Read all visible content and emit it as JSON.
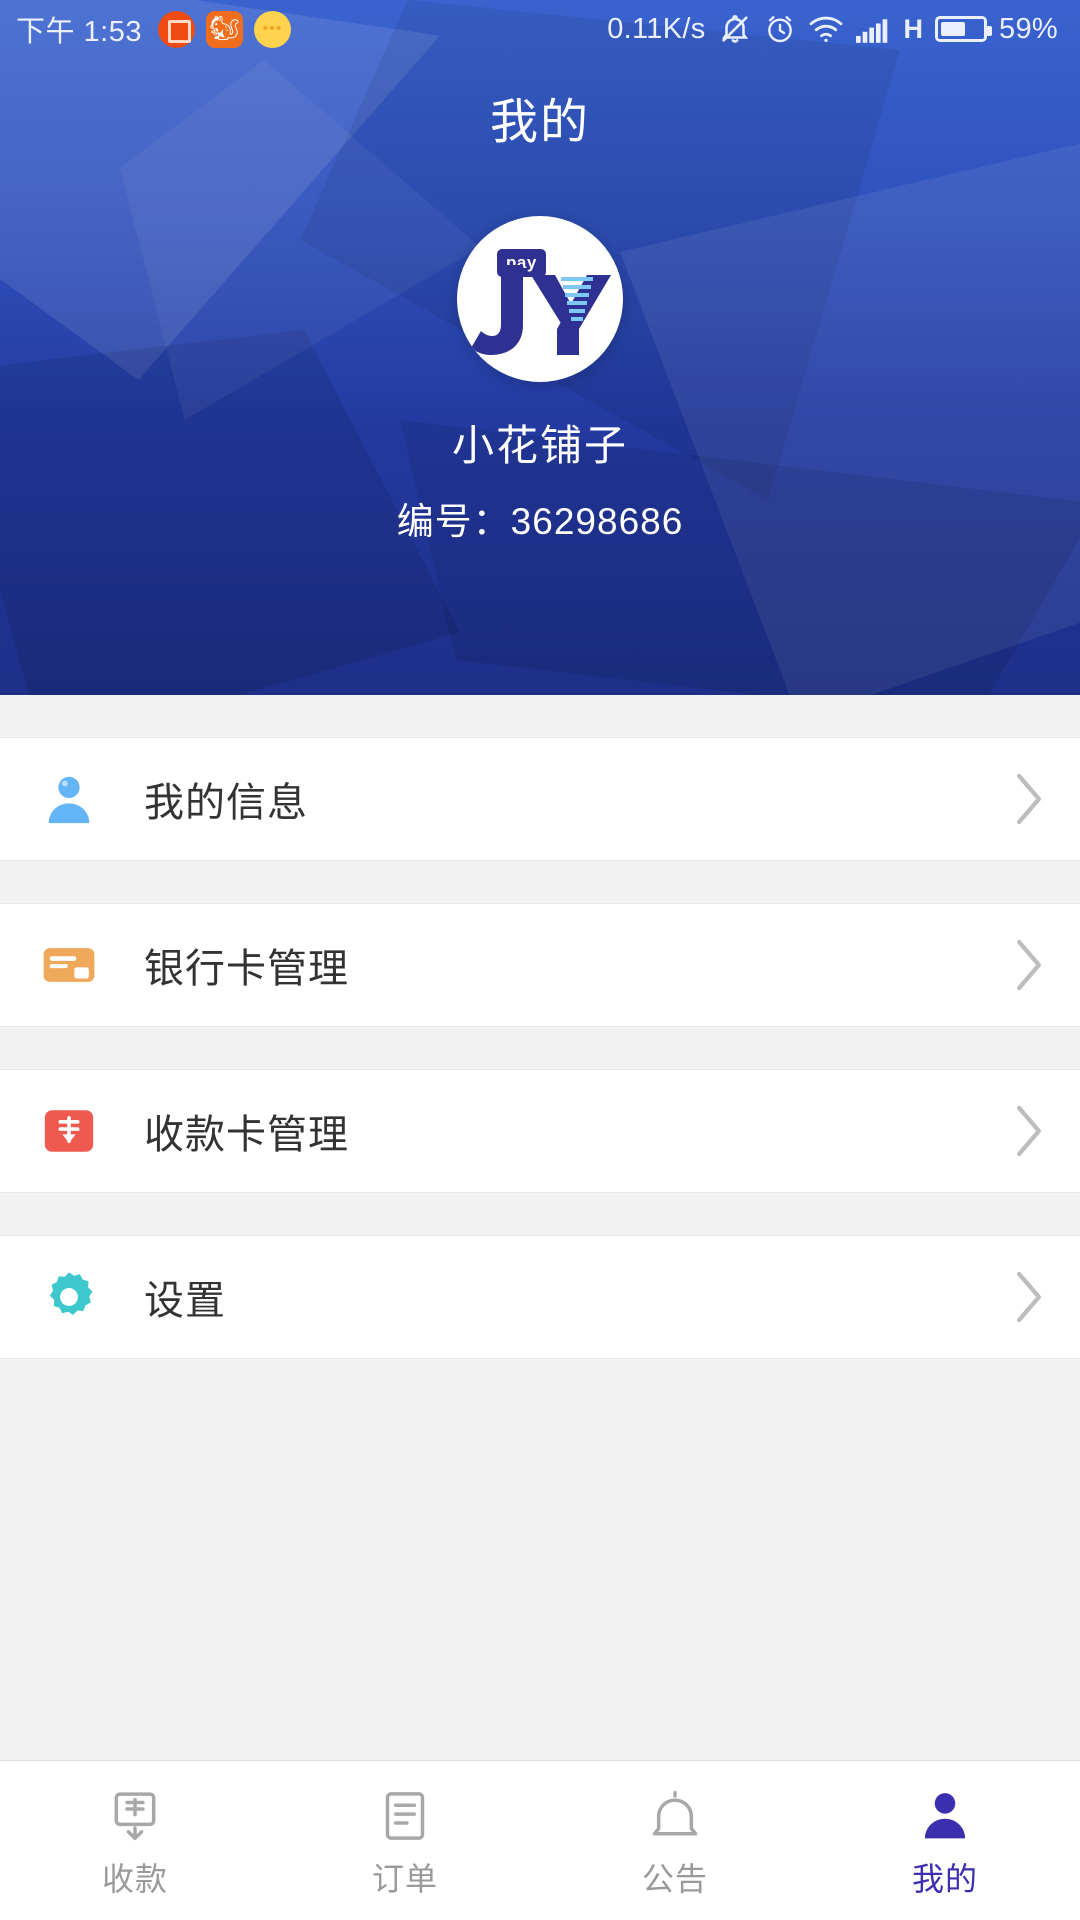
{
  "status_bar": {
    "time": "下午 1:53",
    "network_speed": "0.11K/s",
    "network_type": "H",
    "battery_percent": "59%",
    "battery_level": 59,
    "app_icons": [
      "screenshot-crop-icon",
      "uc-browser-icon",
      "chat-bubble-icon"
    ],
    "status_icons": [
      "mute-bell-icon",
      "alarm-clock-icon",
      "wifi-icon",
      "signal-bars-icon",
      "battery-icon"
    ]
  },
  "header": {
    "title": "我的",
    "avatar": {
      "badge_text": "pay",
      "logo_text": "JY",
      "icon_name": "jy-pay-logo"
    },
    "merchant_name": "小花铺子",
    "merchant_id_label": "编号：",
    "merchant_id_value": "36298686",
    "merchant_id_full": "编号：36298686"
  },
  "menu": {
    "items": [
      {
        "label": "我的信息",
        "icon": "person-icon",
        "icon_color": "#64b5f6",
        "chevron": "chevron-right-icon"
      },
      {
        "label": "银行卡管理",
        "icon": "bank-card-icon",
        "icon_color": "#f0a85a",
        "chevron": "chevron-right-icon"
      },
      {
        "label": "收款卡管理",
        "icon": "receive-card-icon",
        "icon_color": "#ee5a4f",
        "chevron": "chevron-right-icon"
      },
      {
        "label": "设置",
        "icon": "gear-icon",
        "icon_color": "#3cc8cd",
        "chevron": "chevron-right-icon"
      }
    ]
  },
  "tabbar": {
    "items": [
      {
        "label": "收款",
        "icon": "money-receive-icon",
        "active": false
      },
      {
        "label": "订单",
        "icon": "order-list-icon",
        "active": false
      },
      {
        "label": "公告",
        "icon": "bell-icon",
        "active": false
      },
      {
        "label": "我的",
        "icon": "person-filled-icon",
        "active": true
      }
    ],
    "active_index": 3
  },
  "colors": {
    "header_top": "#3a63cf",
    "header_bottom": "#1d2f87",
    "accent_active": "#3b2fb0",
    "text_primary": "#333333",
    "text_muted": "#9a9a9a",
    "page_bg": "#f2f2f2"
  }
}
